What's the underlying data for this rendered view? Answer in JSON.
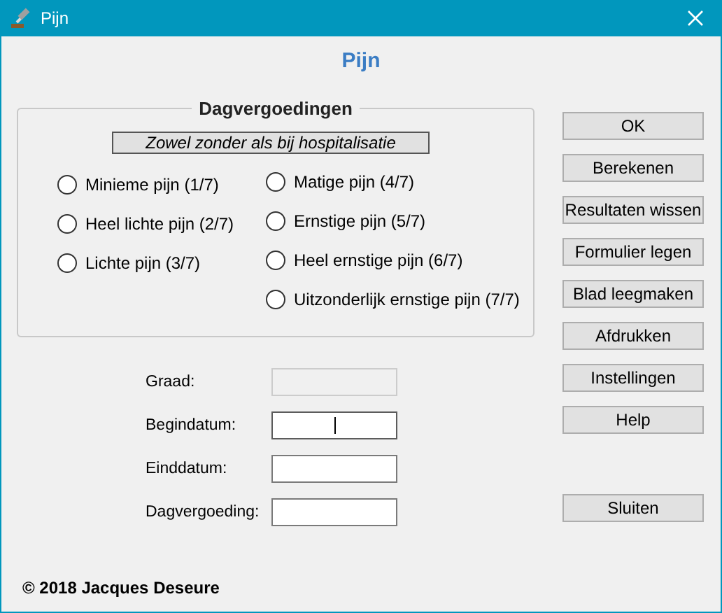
{
  "window": {
    "title": "Pijn"
  },
  "heading": "Pijn",
  "group": {
    "legend": "Dagvergoedingen",
    "banner": "Zowel zonder als bij hospitalisatie",
    "columns": [
      [
        {
          "label": "Minieme pijn (1/7)",
          "selected": false
        },
        {
          "label": "Heel lichte pijn (2/7)",
          "selected": false
        },
        {
          "label": "Lichte pijn (3/7)",
          "selected": false
        }
      ],
      [
        {
          "label": "Matige pijn (4/7)",
          "selected": false
        },
        {
          "label": "Ernstige pijn (5/7)",
          "selected": false
        },
        {
          "label": "Heel ernstige pijn (6/7)",
          "selected": false
        },
        {
          "label": "Uitzonderlijk ernstige pijn (7/7)",
          "selected": false
        }
      ]
    ]
  },
  "fields": [
    {
      "label": "Graad:",
      "disabled": true,
      "focused": false
    },
    {
      "label": "Begindatum:",
      "disabled": false,
      "focused": true
    },
    {
      "label": "Einddatum:",
      "disabled": false,
      "focused": false
    },
    {
      "label": "Dagvergoeding:",
      "disabled": false,
      "focused": false
    }
  ],
  "buttons": [
    "OK",
    "Berekenen",
    "Resultaten wissen",
    "Formulier legen",
    "Blad leegmaken",
    "Afdrukken",
    "Instellingen",
    "Help"
  ],
  "close_button": "Sluiten",
  "footer": "© 2018 Jacques Deseure"
}
